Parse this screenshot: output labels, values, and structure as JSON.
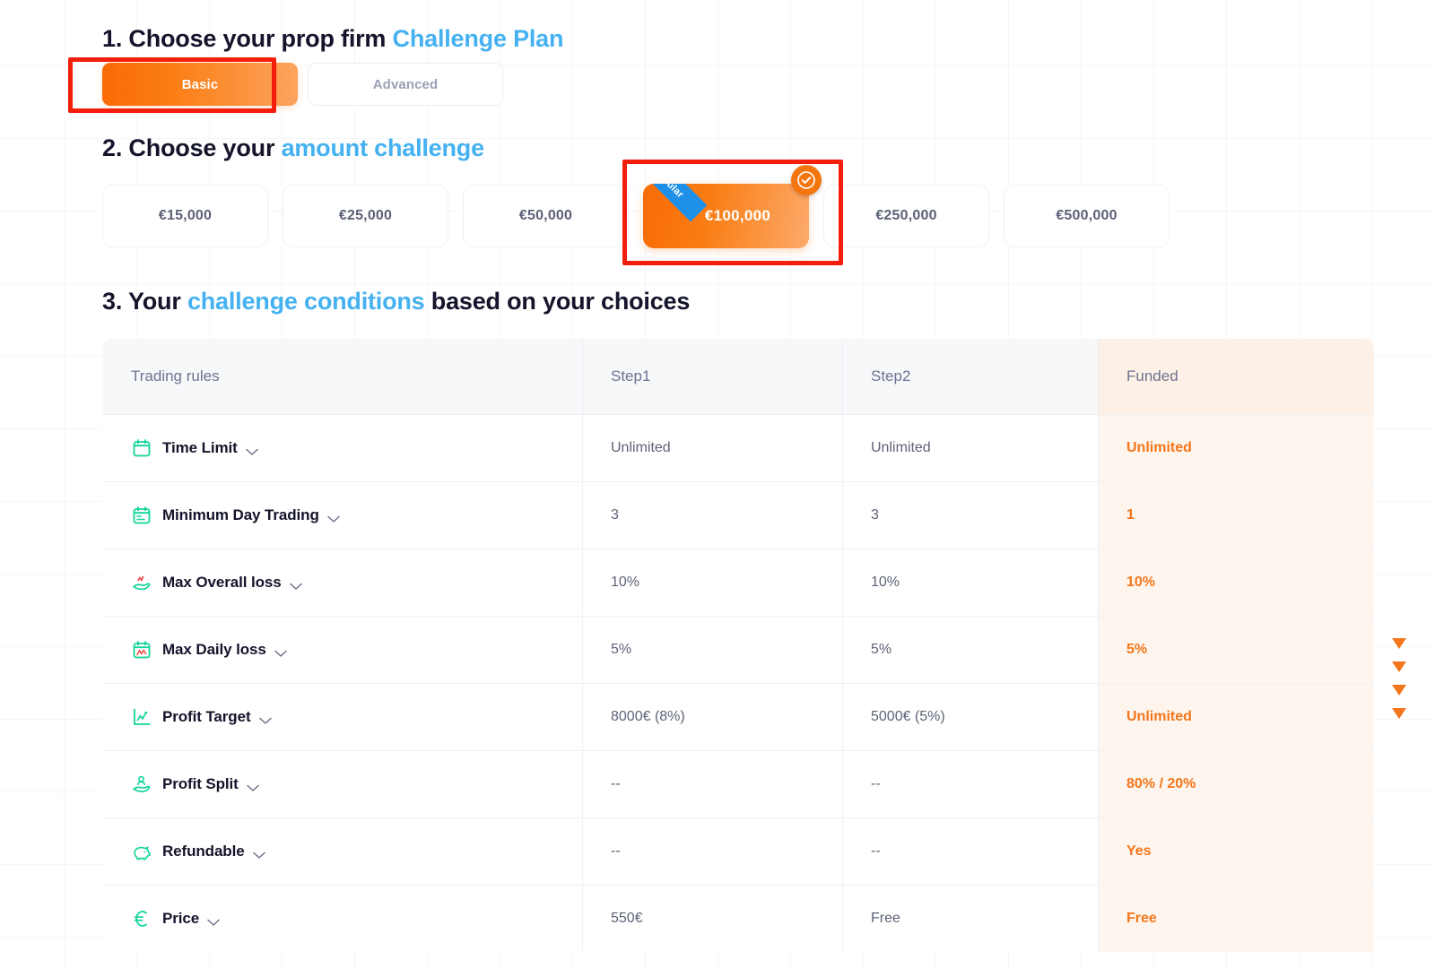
{
  "steps": {
    "step1": {
      "num": "1.",
      "text_before": " Choose your prop firm ",
      "accent": "Challenge Plan"
    },
    "step2": {
      "num": "2.",
      "text_before": " Choose your ",
      "accent": "amount challenge"
    },
    "step3": {
      "num": "3.",
      "text_before": " Your ",
      "accent": "challenge conditions",
      "text_after": " based on your choices"
    }
  },
  "plan_toggle": {
    "options": [
      {
        "label": "Basic",
        "selected": true
      },
      {
        "label": "Advanced",
        "selected": false
      }
    ]
  },
  "amounts": {
    "options": [
      {
        "label": "€15,000",
        "selected": false
      },
      {
        "label": "€25,000",
        "selected": false
      },
      {
        "label": "€50,000",
        "selected": false
      },
      {
        "label": "€100,000",
        "selected": true,
        "ribbon": "popular"
      },
      {
        "label": "€250,000",
        "selected": false
      },
      {
        "label": "€500,000",
        "selected": false
      }
    ]
  },
  "table": {
    "headers": [
      "Trading rules",
      "Step1",
      "Step2",
      "Funded"
    ],
    "rows": [
      {
        "icon": "calendar-icon",
        "label": "Time Limit",
        "step1": "Unlimited",
        "step2": "Unlimited",
        "funded": "Unlimited"
      },
      {
        "icon": "calendar-days-icon",
        "label": "Minimum Day Trading",
        "step1": "3",
        "step2": "3",
        "funded": "1"
      },
      {
        "icon": "hand-loss-icon",
        "label": "Max Overall loss",
        "step1": "10%",
        "step2": "10%",
        "funded": "10%"
      },
      {
        "icon": "calendar-loss-icon",
        "label": "Max Daily loss",
        "step1": "5%",
        "step2": "5%",
        "funded": "5%"
      },
      {
        "icon": "chart-up-icon",
        "label": "Profit Target",
        "step1": "8000€ (8%)",
        "step2": "5000€ (5%)",
        "funded": "Unlimited"
      },
      {
        "icon": "hand-user-icon",
        "label": "Profit Split",
        "step1": "--",
        "step2": "--",
        "funded": "80% / 20%"
      },
      {
        "icon": "piggy-bank-icon",
        "label": "Refundable",
        "step1": "--",
        "step2": "--",
        "funded": "Yes"
      },
      {
        "icon": "euro-icon",
        "label": "Price",
        "step1": "550€",
        "step2": "Free",
        "funded": "Free"
      }
    ]
  },
  "scroll_arrows": {
    "count": 4,
    "direction": "down"
  },
  "colors": {
    "accent_blue": "#45b1f0",
    "brand_orange": "#f4761a",
    "icon_green": "#10d49a",
    "icon_red": "#ef4444",
    "funded_bg": "#fef5ee",
    "ribbon_blue": "#1e90e8",
    "annotation_red": "#f41e0c"
  }
}
